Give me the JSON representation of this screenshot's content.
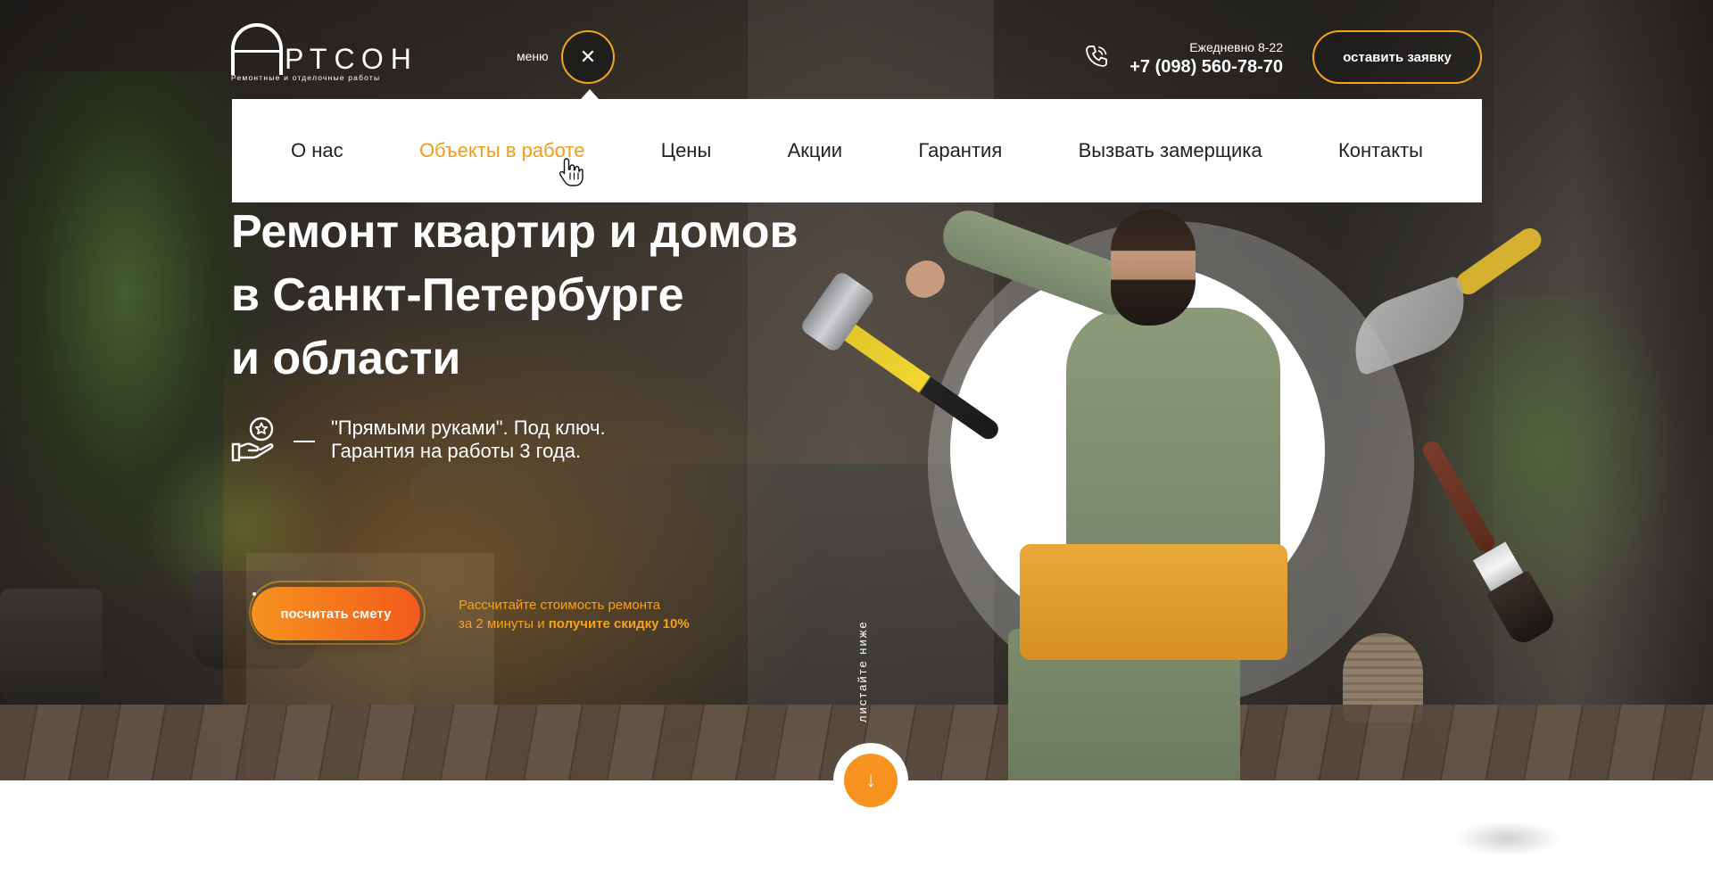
{
  "header": {
    "logo": {
      "letter": "А",
      "rest": "РТСОН",
      "tagline": "Ремонтные и отделочные работы"
    },
    "menu_label": "меню",
    "menu_close_glyph": "✕",
    "schedule": "Ежедневно 8-22",
    "phone": "+7 (098) 560-78-70",
    "request_button": "оставить заявку"
  },
  "nav": {
    "items": [
      {
        "label": "О нас",
        "active": false
      },
      {
        "label": "Объекты в работе",
        "active": true
      },
      {
        "label": "Цены",
        "active": false
      },
      {
        "label": "Акции",
        "active": false
      },
      {
        "label": "Гарантия",
        "active": false
      },
      {
        "label": "Вызвать замерщика",
        "active": false
      },
      {
        "label": "Контакты",
        "active": false
      }
    ]
  },
  "hero": {
    "title_lines": [
      "Ремонт квартир и домов",
      "в Санкт-Петербурге",
      "и области"
    ],
    "feature_lines": [
      "\"Прямыми руками\". Под ключ.",
      "Гарантия на работы 3 года."
    ],
    "calc_button": "посчитать смету",
    "calc_note_line1": "Рассчитайте стоимость ремонта",
    "calc_note_line2_prefix": "за 2 минуты и ",
    "calc_note_line2_bold": "получите скидку 10%",
    "scroll_hint": "листайте ниже",
    "scroll_arrow": "↓"
  },
  "icons": {
    "phone": "phone-icon",
    "feature": "hand-star-icon",
    "close": "close-icon",
    "cursor": "pointer-hand-icon",
    "scroll": "arrow-down-icon"
  },
  "colors": {
    "accent": "#f7a21a",
    "accent_active_nav": "#f29b16",
    "button_gradient_start": "#f7931e",
    "button_gradient_end": "#f15a1c"
  }
}
